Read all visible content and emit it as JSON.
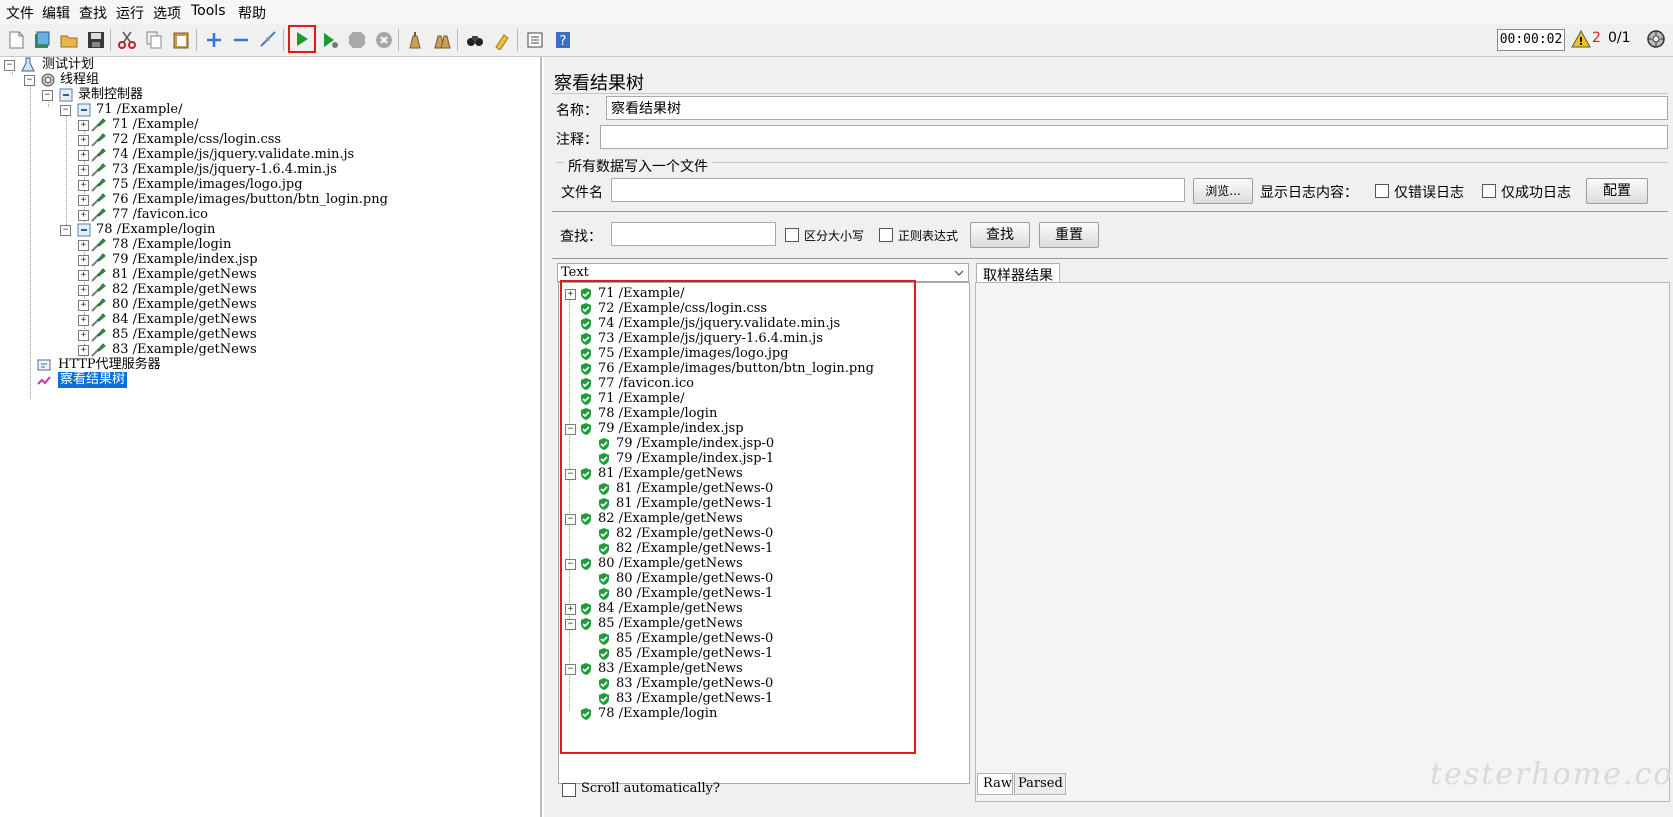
{
  "menu": [
    "文件",
    "编辑",
    "查找",
    "运行",
    "选项",
    "Tools",
    "帮助"
  ],
  "toolbar": {
    "icons": [
      "new-icon",
      "templates-icon",
      "open-icon",
      "save-icon",
      "cut-icon",
      "copy-icon",
      "paste-icon",
      "expand-icon",
      "collapse-icon",
      "toggle-icon",
      "start-icon",
      "start-no-pause-icon",
      "stop-icon",
      "shutdown-icon",
      "clear-icon",
      "clear-all-icon",
      "search-icon",
      "reset-search-icon",
      "function-helper-icon",
      "help-icon"
    ],
    "timer": "00:00:02",
    "warning_count": "2",
    "threads": "0/1"
  },
  "tree": {
    "root": "测试计划",
    "thread_group": "线程组",
    "recorder": "录制控制器",
    "group1": "71 /Example/",
    "group1_items": [
      "71 /Example/",
      "72 /Example/css/login.css",
      "74 /Example/js/jquery.validate.min.js",
      "73 /Example/js/jquery-1.6.4.min.js",
      "75 /Example/images/logo.jpg",
      "76 /Example/images/button/btn_login.png",
      "77 /favicon.ico"
    ],
    "group2": "78 /Example/login",
    "group2_items": [
      "78 /Example/login",
      "79 /Example/index.jsp",
      "81 /Example/getNews",
      "82 /Example/getNews",
      "80 /Example/getNews",
      "84 /Example/getNews",
      "85 /Example/getNews",
      "83 /Example/getNews"
    ],
    "proxy": "HTTP代理服务器",
    "listener": "察看结果树"
  },
  "panel": {
    "title": "察看结果树",
    "name_label": "名称：",
    "name_value": "察看结果树",
    "comment_label": "注释：",
    "comment_value": "",
    "file_section": "所有数据写入一个文件",
    "file_label": "文件名",
    "file_value": "",
    "browse": "浏览...",
    "log_label": "显示日志内容：",
    "errors_only": "仅错误日志",
    "success_only": "仅成功日志",
    "configure": "配置",
    "search_label": "查找：",
    "search_value": "",
    "case_sensitive": "区分大小写",
    "regex": "正则表达式",
    "search_btn": "查找",
    "reset_btn": "重置",
    "renderer": "Text",
    "scroll_auto": "Scroll automatically?",
    "sampler_tab": "取样器结果",
    "raw_tab": "Raw",
    "parsed_tab": "Parsed"
  },
  "results": [
    {
      "text": "71 /Example/",
      "level": 0,
      "exp": "+"
    },
    {
      "text": "72 /Example/css/login.css",
      "level": 0,
      "exp": ""
    },
    {
      "text": "74 /Example/js/jquery.validate.min.js",
      "level": 0,
      "exp": ""
    },
    {
      "text": "73 /Example/js/jquery-1.6.4.min.js",
      "level": 0,
      "exp": ""
    },
    {
      "text": "75 /Example/images/logo.jpg",
      "level": 0,
      "exp": ""
    },
    {
      "text": "76 /Example/images/button/btn_login.png",
      "level": 0,
      "exp": ""
    },
    {
      "text": "77 /favicon.ico",
      "level": 0,
      "exp": ""
    },
    {
      "text": "71 /Example/",
      "level": 0,
      "exp": ""
    },
    {
      "text": "78 /Example/login",
      "level": 0,
      "exp": ""
    },
    {
      "text": "79 /Example/index.jsp",
      "level": 0,
      "exp": "−"
    },
    {
      "text": "79 /Example/index.jsp-0",
      "level": 1,
      "exp": ""
    },
    {
      "text": "79 /Example/index.jsp-1",
      "level": 1,
      "exp": ""
    },
    {
      "text": "81 /Example/getNews",
      "level": 0,
      "exp": "−"
    },
    {
      "text": "81 /Example/getNews-0",
      "level": 1,
      "exp": ""
    },
    {
      "text": "81 /Example/getNews-1",
      "level": 1,
      "exp": ""
    },
    {
      "text": "82 /Example/getNews",
      "level": 0,
      "exp": "−"
    },
    {
      "text": "82 /Example/getNews-0",
      "level": 1,
      "exp": ""
    },
    {
      "text": "82 /Example/getNews-1",
      "level": 1,
      "exp": ""
    },
    {
      "text": "80 /Example/getNews",
      "level": 0,
      "exp": "−"
    },
    {
      "text": "80 /Example/getNews-0",
      "level": 1,
      "exp": ""
    },
    {
      "text": "80 /Example/getNews-1",
      "level": 1,
      "exp": ""
    },
    {
      "text": "84 /Example/getNews",
      "level": 0,
      "exp": "+"
    },
    {
      "text": "85 /Example/getNews",
      "level": 0,
      "exp": "−"
    },
    {
      "text": "85 /Example/getNews-0",
      "level": 1,
      "exp": ""
    },
    {
      "text": "85 /Example/getNews-1",
      "level": 1,
      "exp": ""
    },
    {
      "text": "83 /Example/getNews",
      "level": 0,
      "exp": "−"
    },
    {
      "text": "83 /Example/getNews-0",
      "level": 1,
      "exp": ""
    },
    {
      "text": "83 /Example/getNews-1",
      "level": 1,
      "exp": ""
    },
    {
      "text": "78 /Example/login",
      "level": 0,
      "exp": ""
    }
  ],
  "watermark": "testerhome.com",
  "colors": {
    "selection": "#0a6fd6",
    "success": "#1f9d3a",
    "highlight_box": "#e11b1b",
    "warning": "#f0c419"
  }
}
